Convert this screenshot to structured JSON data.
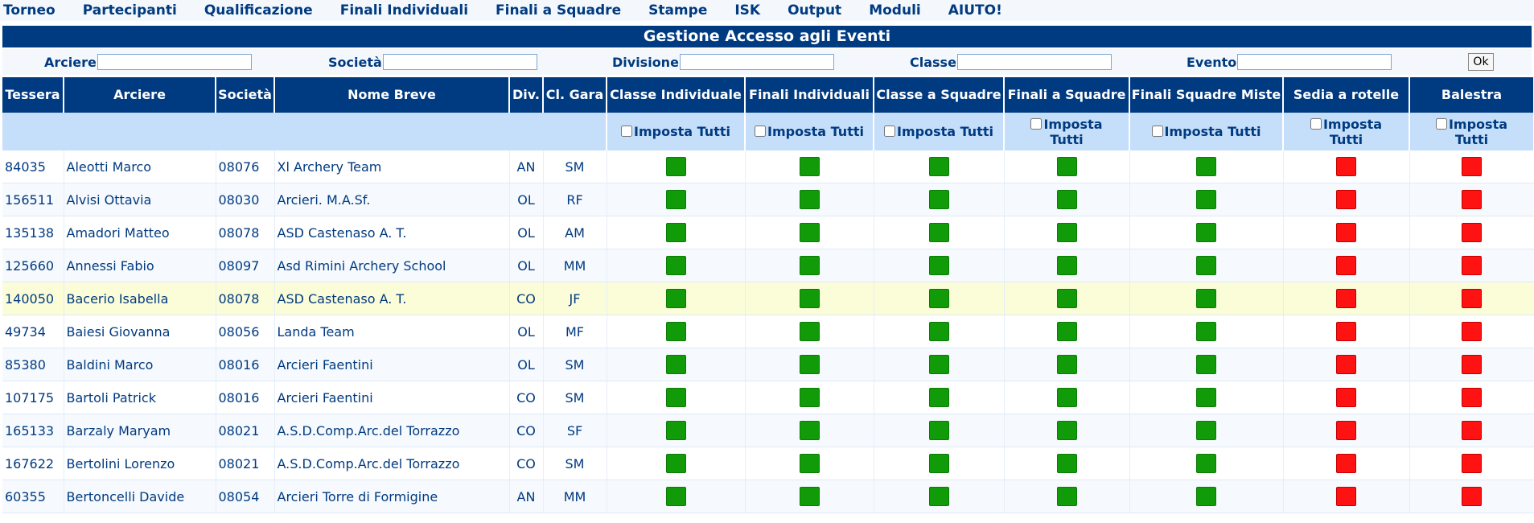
{
  "menu": [
    "Torneo",
    "Partecipanti",
    "Qualificazione",
    "Finali Individuali",
    "Finali a Squadre",
    "Stampe",
    "ISK",
    "Output",
    "Moduli",
    "AIUTO!"
  ],
  "title": "Gestione Accesso agli Eventi",
  "filters": {
    "arciere": "Arciere",
    "societa": "Società",
    "divisione": "Divisione",
    "classe": "Classe",
    "evento": "Evento",
    "ok": "Ok"
  },
  "columns": {
    "tessera": "Tessera",
    "arciere": "Arciere",
    "societa": "Società",
    "nome_breve": "Nome Breve",
    "div": "Div.",
    "cl_gara": "Cl. Gara",
    "classe_individuale": "Classe Individuale",
    "finali_individuali": "Finali Individuali",
    "classe_a_squadre": "Classe a Squadre",
    "finali_a_squadre": "Finali a Squadre",
    "finali_squadre_miste": "Finali Squadre Miste",
    "sedia_a_rotelle": "Sedia a rotelle",
    "balestra": "Balestra"
  },
  "set_all_label": "Imposta Tutti",
  "status_colors": {
    "on": "#119b08",
    "off": "#ff1212"
  },
  "rows": [
    {
      "tessera": "84035",
      "arciere": "Aleotti Marco",
      "societa": "08076",
      "nome": "Xl Archery Team",
      "div": "AN",
      "cl": "SM"
    },
    {
      "tessera": "156511",
      "arciere": "Alvisi Ottavia",
      "societa": "08030",
      "nome": "Arcieri. M.A.Sf.",
      "div": "OL",
      "cl": "RF"
    },
    {
      "tessera": "135138",
      "arciere": "Amadori Matteo",
      "societa": "08078",
      "nome": "ASD Castenaso A. T.",
      "div": "OL",
      "cl": "AM"
    },
    {
      "tessera": "125660",
      "arciere": "Annessi Fabio",
      "societa": "08097",
      "nome": "Asd Rimini Archery School",
      "div": "OL",
      "cl": "MM"
    },
    {
      "tessera": "140050",
      "arciere": "Bacerio Isabella",
      "societa": "08078",
      "nome": "ASD Castenaso A. T.",
      "div": "CO",
      "cl": "JF"
    },
    {
      "tessera": "49734",
      "arciere": "Baiesi Giovanna",
      "societa": "08056",
      "nome": "Landa Team",
      "div": "OL",
      "cl": "MF"
    },
    {
      "tessera": "85380",
      "arciere": "Baldini Marco",
      "societa": "08016",
      "nome": "Arcieri Faentini",
      "div": "OL",
      "cl": "SM"
    },
    {
      "tessera": "107175",
      "arciere": "Bartoli Patrick",
      "societa": "08016",
      "nome": "Arcieri Faentini",
      "div": "CO",
      "cl": "SM"
    },
    {
      "tessera": "165133",
      "arciere": "Barzaly Maryam",
      "societa": "08021",
      "nome": "A.S.D.Comp.Arc.del Torrazzo",
      "div": "CO",
      "cl": "SF"
    },
    {
      "tessera": "167622",
      "arciere": "Bertolini Lorenzo",
      "societa": "08021",
      "nome": "A.S.D.Comp.Arc.del Torrazzo",
      "div": "CO",
      "cl": "SM"
    },
    {
      "tessera": "60355",
      "arciere": "Bertoncelli Davide",
      "societa": "08054",
      "nome": "Arcieri Torre di Formigine",
      "div": "AN",
      "cl": "MM"
    }
  ]
}
